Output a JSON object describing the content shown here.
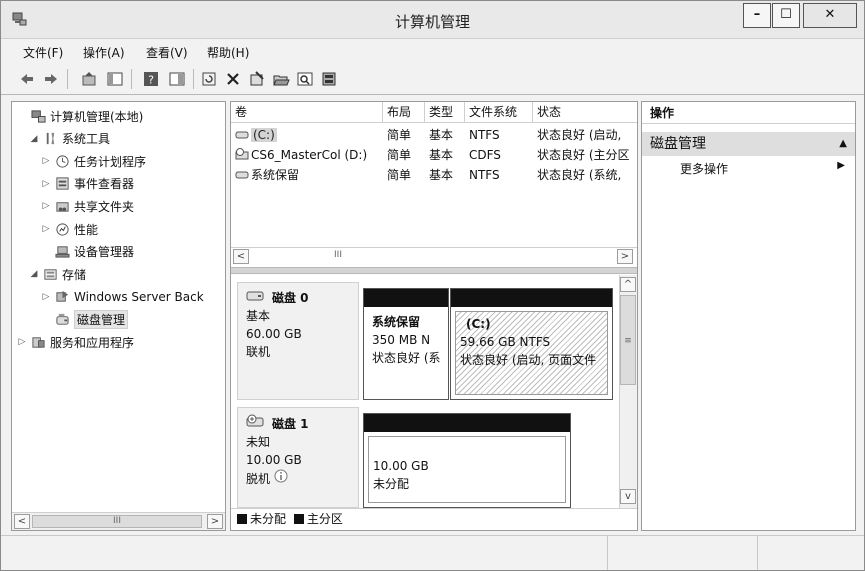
{
  "window": {
    "title": "计算机管理",
    "minimize": "–",
    "maximize": "☐",
    "close": "✕"
  },
  "menu": [
    "文件(F)",
    "操作(A)",
    "查看(V)",
    "帮助(H)"
  ],
  "toolbar_icons": [
    "back-arrow-icon",
    "forward-arrow-icon",
    "up-folder-icon",
    "show-hide-tree-icon",
    "help-icon",
    "show-pane-icon",
    "refresh-icon",
    "delete-icon",
    "properties-icon",
    "open-folder-icon",
    "search-icon",
    "disk-settings-icon"
  ],
  "tree": [
    {
      "label": "计算机管理(本地)",
      "indent": 0,
      "twisty": "",
      "icon": "computer-management-icon"
    },
    {
      "label": "系统工具",
      "indent": 1,
      "twisty": "◢",
      "icon": "tools-icon"
    },
    {
      "label": "任务计划程序",
      "indent": 2,
      "twisty": "▷",
      "icon": "clock-icon"
    },
    {
      "label": "事件查看器",
      "indent": 2,
      "twisty": "▷",
      "icon": "event-viewer-icon"
    },
    {
      "label": "共享文件夹",
      "indent": 2,
      "twisty": "▷",
      "icon": "shared-folder-icon"
    },
    {
      "label": "性能",
      "indent": 2,
      "twisty": "▷",
      "icon": "performance-icon"
    },
    {
      "label": "设备管理器",
      "indent": 2,
      "twisty": "",
      "icon": "device-manager-icon"
    },
    {
      "label": "存储",
      "indent": 1,
      "twisty": "◢",
      "icon": "storage-icon"
    },
    {
      "label": "Windows Server Back",
      "indent": 2,
      "twisty": "▷",
      "icon": "backup-icon"
    },
    {
      "label": "磁盘管理",
      "indent": 2,
      "twisty": "",
      "icon": "disk-management-icon",
      "selected": true
    },
    {
      "label": "服务和应用程序",
      "indent": 0,
      "twisty": "▷",
      "icon": "services-icon"
    }
  ],
  "left_scroll": {
    "left": "<",
    "right": ">",
    "thumb": "III"
  },
  "volumes": {
    "columns": [
      "卷",
      "布局",
      "类型",
      "文件系统",
      "状态"
    ],
    "rows": [
      {
        "name": "(C:)",
        "layout": "简单",
        "type": "基本",
        "fs": "NTFS",
        "status": "状态良好 (启动,",
        "icon": "drive-icon",
        "selected": true
      },
      {
        "name": "CS6_MasterCol (D:)",
        "layout": "简单",
        "type": "基本",
        "fs": "CDFS",
        "status": "状态良好 (主分区",
        "icon": "cd-drive-icon"
      },
      {
        "name": "系统保留",
        "layout": "简单",
        "type": "基本",
        "fs": "NTFS",
        "status": "状态良好 (系统,",
        "icon": "drive-icon"
      }
    ]
  },
  "vol_scroll": {
    "left": "<",
    "right": ">",
    "thumb": "III"
  },
  "disk_scroll": {
    "up": "^",
    "down": "v",
    "thumb": "≡"
  },
  "disks": [
    {
      "name": "磁盘 0",
      "type": "基本",
      "size": "60.00 GB",
      "state": "联机",
      "partitions": [
        {
          "title": "系统保留",
          "size": "350 MB N",
          "status": "状态良好 (系"
        },
        {
          "title": "(C:)",
          "size": "59.66 GB NTFS",
          "status": "状态良好 (启动, 页面文件"
        }
      ]
    },
    {
      "name": "磁盘 1",
      "type": "未知",
      "size": "10.00 GB",
      "state": "脱机",
      "partitions": [
        {
          "title": "",
          "size": "10.00 GB",
          "status": "未分配"
        }
      ]
    }
  ],
  "legend": [
    "未分配",
    "主分区"
  ],
  "actions": {
    "header": "操作",
    "group": "磁盘管理",
    "group_arrow": "▲",
    "item": "更多操作",
    "item_arrow": "▶"
  },
  "colors": {
    "unallocated": "#111111",
    "primary": "#111111",
    "selected_bg": "#d4d4d4"
  }
}
